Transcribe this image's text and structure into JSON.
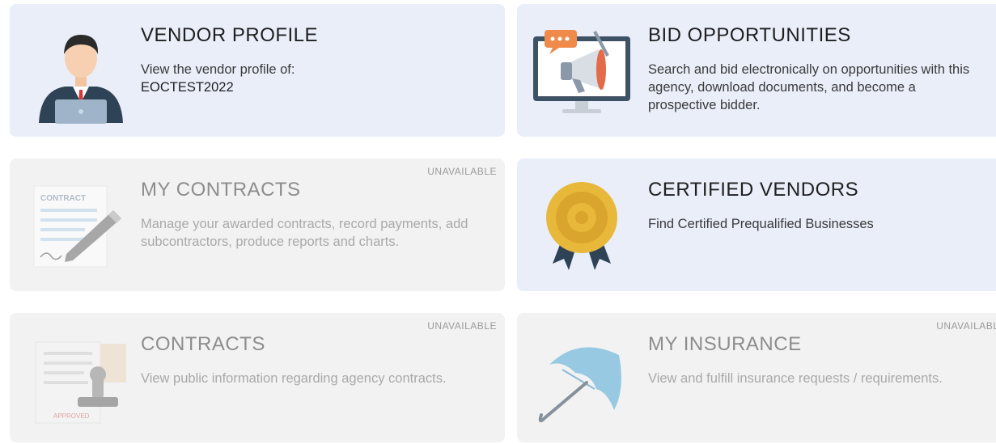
{
  "cards": [
    {
      "title": "VENDOR PROFILE",
      "description": "View the vendor profile of:",
      "subtext": "EOCTEST2022",
      "icon": "businessman-laptop-icon",
      "available": true
    },
    {
      "title": "BID OPPORTUNITIES",
      "description": "Search and bid electronically on opportunities with this agency, download documents, and become a prospective bidder.",
      "icon": "monitor-megaphone-icon",
      "available": true
    },
    {
      "title": "MY CONTRACTS",
      "description": "Manage your awarded contracts, record payments, add subcontractors, produce reports and charts.",
      "badge": "UNAVAILABLE",
      "icon": "contract-pen-icon",
      "icon_text": "CONTRACT",
      "available": false
    },
    {
      "title": "CERTIFIED VENDORS",
      "description": "Find Certified Prequalified Businesses",
      "icon": "certificate-badge-icon",
      "available": true
    },
    {
      "title": "CONTRACTS",
      "description": "View public information regarding agency contracts.",
      "badge": "UNAVAILABLE",
      "icon": "approved-stamp-icon",
      "icon_text": "APPROVED",
      "available": false
    },
    {
      "title": "MY INSURANCE",
      "description": "View and fulfill insurance requests / requirements.",
      "badge": "UNAVAILABLE",
      "icon": "umbrella-icon",
      "available": false
    }
  ],
  "colors": {
    "active_card": "#e9eef9",
    "disabled_card": "#f2f2f2",
    "accent_blue": "#5b7fa8",
    "gold": "#e8b83a"
  }
}
